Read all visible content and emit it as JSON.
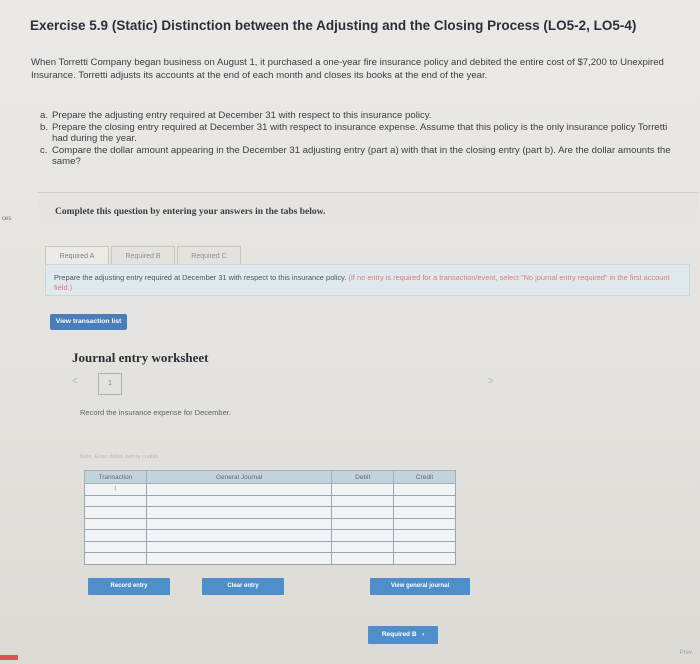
{
  "side_mark": "ces",
  "title": "Exercise 5.9 (Static) Distinction between the Adjusting and the Closing Process (LO5-2, LO5-4)",
  "intro": "When Torretti Company began business on August 1, it purchased a one-year fire insurance policy and debited the entire cost of $7,200 to Unexpired Insurance. Torretti adjusts its accounts at the end of each month and closes its books at the end of the year.",
  "requirements": [
    {
      "letter": "a.",
      "text": "Prepare the adjusting entry required at December 31 with respect to this insurance policy."
    },
    {
      "letter": "b.",
      "text": "Prepare the closing entry required at December 31 with respect to insurance expense. Assume that this policy is the only insurance policy Torretti had during the year."
    },
    {
      "letter": "c.",
      "text": "Compare the dollar amount appearing in the December 31 adjusting entry (part a) with that in the closing entry (part b). Are the dollar amounts the same?"
    }
  ],
  "complete_prompt": "Complete this question by entering your answers in the tabs below.",
  "tabs": [
    "Required A",
    "Required B",
    "Required C"
  ],
  "instruction": "Prepare the adjusting entry required at December 31 with respect to this insurance policy.",
  "instruction_hint": "(If no entry is required for a transaction/event, select \"No journal entry required\" in the first account field.)",
  "view_transaction_list": "View transaction list",
  "worksheet": {
    "title": "Journal entry worksheet",
    "prev": "<",
    "next": ">",
    "page": "1",
    "record_text": "Record the insurance expense for December.",
    "note": "Note: Enter debits before credits.",
    "headers": {
      "transaction": "Transaction",
      "journal": "General Journal",
      "debit": "Debit",
      "credit": "Credit"
    },
    "first_row_num": "1"
  },
  "buttons": {
    "record": "Record entry",
    "clear": "Clear entry",
    "view_journal": "View general journal",
    "required_next": "Required B"
  },
  "footer_nav": "Prev"
}
